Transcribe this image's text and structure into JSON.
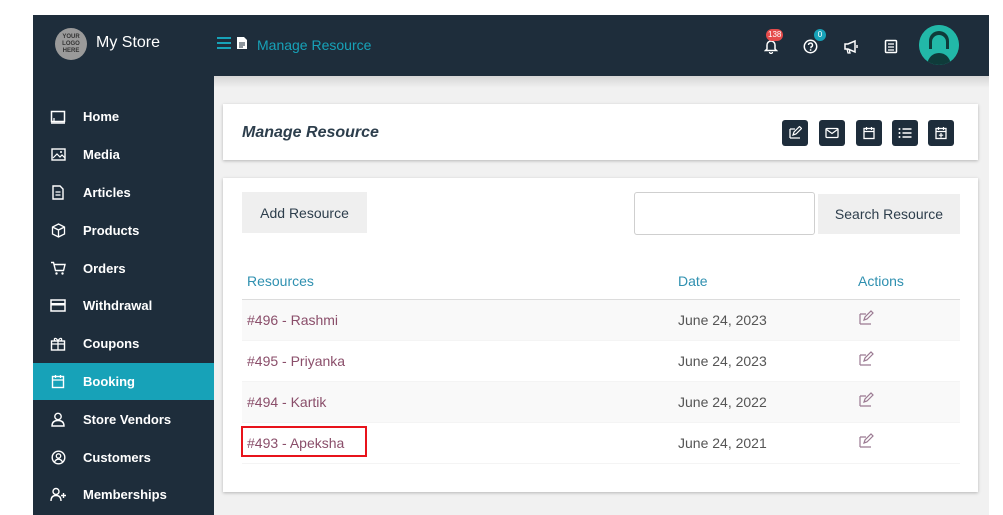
{
  "topbar": {
    "logo_text": "YOUR LOGO HERE",
    "store_name": "My Store",
    "page_heading": "Manage Resource",
    "notifications_count": "138",
    "help_count": "0"
  },
  "sidebar": {
    "items": [
      {
        "label": "Home",
        "icon": "monitor-icon"
      },
      {
        "label": "Media",
        "icon": "image-icon"
      },
      {
        "label": "Articles",
        "icon": "document-icon"
      },
      {
        "label": "Products",
        "icon": "cube-icon"
      },
      {
        "label": "Orders",
        "icon": "cart-icon"
      },
      {
        "label": "Withdrawal",
        "icon": "credit-card-icon"
      },
      {
        "label": "Coupons",
        "icon": "gift-icon"
      },
      {
        "label": "Booking",
        "icon": "calendar-icon"
      },
      {
        "label": "Store Vendors",
        "icon": "user-icon"
      },
      {
        "label": "Customers",
        "icon": "user-circle-icon"
      },
      {
        "label": "Memberships",
        "icon": "user-plus-icon"
      }
    ],
    "active": "Booking"
  },
  "header": {
    "title": "Manage Resource",
    "toolbar": [
      "edit-icon",
      "mail-icon",
      "calendar-icon",
      "list-icon",
      "calendar-plus-icon"
    ]
  },
  "list": {
    "add_label": "Add Resource",
    "search_value": "",
    "search_label": "Search Resource",
    "columns": [
      "Resources",
      "Date",
      "Actions"
    ],
    "rows": [
      {
        "resource": "#496 - Rashmi",
        "date": "June 24, 2023"
      },
      {
        "resource": "#495 - Priyanka",
        "date": "June 24, 2023"
      },
      {
        "resource": "#494 - Kartik",
        "date": "June 24, 2022"
      },
      {
        "resource": "#493 - Apeksha",
        "date": "June 24, 2021"
      }
    ],
    "highlighted_row": "#493 - Apeksha"
  },
  "colors": {
    "nav_bg": "#1e2d3b",
    "accent": "#17a2b8",
    "link": "#8a4e6a",
    "highlight": "#e8131b"
  }
}
